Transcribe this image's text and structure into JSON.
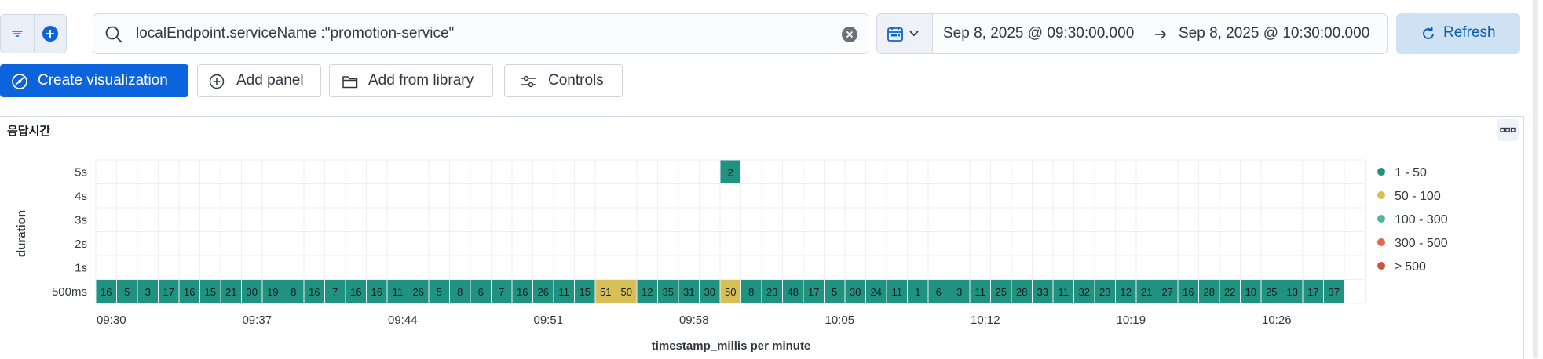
{
  "query": {
    "value": "localEndpoint.serviceName :\"promotion-service\""
  },
  "time_range": {
    "start": "Sep 8, 2025 @ 09:30:00.000",
    "end": "Sep 8, 2025 @ 10:30:00.000"
  },
  "toolbar": {
    "refresh_label": "Refresh",
    "create_visualization_label": "Create visualization",
    "add_panel_label": "Add panel",
    "add_from_library_label": "Add from library",
    "controls_label": "Controls"
  },
  "panel": {
    "title": "응답시간"
  },
  "colors": {
    "accent": "#0b64dd",
    "range_1_50": "#209280",
    "range_50_100": "#d6bf57",
    "range_100_300": "#54b399",
    "range_300_500": "#e7664c",
    "range_500_plus": "#cc5642"
  },
  "chart_data": {
    "type": "heatmap",
    "xlabel": "timestamp_millis per minute",
    "ylabel": "duration",
    "y_categories": [
      "500ms",
      "1s",
      "2s",
      "3s",
      "4s",
      "5s"
    ],
    "x_tick_labels": [
      "09:30",
      "09:37",
      "09:44",
      "09:51",
      "09:58",
      "10:05",
      "10:12",
      "10:19",
      "10:26"
    ],
    "x_start": "09:30",
    "legend": [
      "1 - 50",
      "50 - 100",
      "100 - 300",
      "300 - 500",
      "≥ 500"
    ],
    "legend_position": "right",
    "grid": true,
    "series": [
      {
        "y": "500ms",
        "values": [
          16,
          5,
          3,
          17,
          16,
          15,
          21,
          30,
          19,
          8,
          16,
          7,
          16,
          16,
          11,
          26,
          5,
          8,
          6,
          7,
          16,
          26,
          11,
          15,
          51,
          50,
          12,
          35,
          31,
          30,
          50,
          8,
          23,
          48,
          17,
          5,
          30,
          24,
          11,
          1,
          6,
          3,
          11,
          25,
          28,
          33,
          11,
          32,
          23,
          12,
          21,
          27,
          16,
          28,
          22,
          10,
          25,
          13,
          17,
          37
        ]
      },
      {
        "y": "5s",
        "points": [
          {
            "x": "10:00",
            "value": 2
          }
        ]
      }
    ]
  }
}
